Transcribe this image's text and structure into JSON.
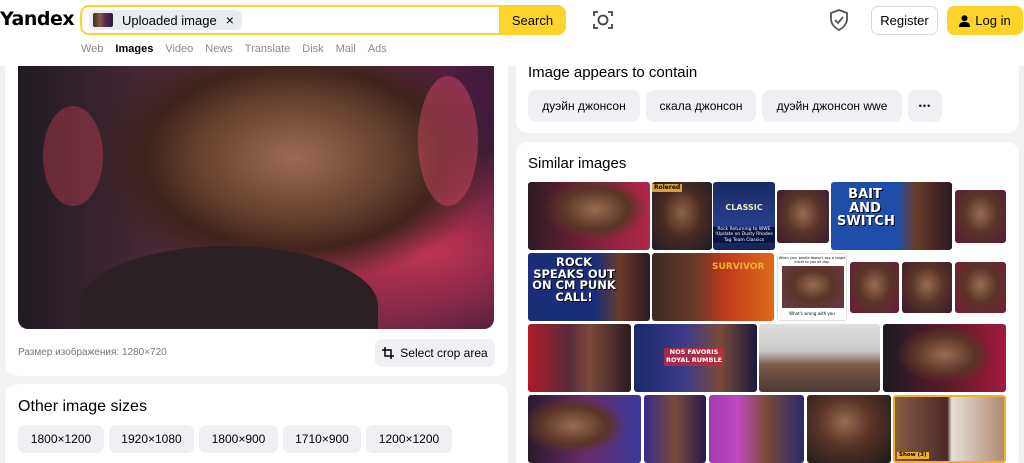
{
  "header": {
    "logo": "Yandex",
    "search": {
      "chip_label": "Uploaded image",
      "chip_close": "×",
      "button": "Search"
    },
    "register": "Register",
    "login": "Log in",
    "icons": {
      "camera": "camera-lens-icon",
      "shield": "shield-check-icon",
      "user": "user-icon"
    }
  },
  "tabs": [
    {
      "label": "Web"
    },
    {
      "label": "Images",
      "active": true
    },
    {
      "label": "Video"
    },
    {
      "label": "News"
    },
    {
      "label": "Translate"
    },
    {
      "label": "Disk"
    },
    {
      "label": "Mail"
    },
    {
      "label": "Ads"
    }
  ],
  "left": {
    "image_size_text": "Размер изображения: 1280×720",
    "crop_button": "Select crop area",
    "other_sizes_title": "Other image sizes",
    "sizes": [
      "1800×1200",
      "1920×1080",
      "1800×900",
      "1710×900",
      "1200×1200"
    ]
  },
  "right": {
    "contains_title": "Image appears to contain",
    "tags": [
      "дуэйн джонсон",
      "скала джонсон",
      "дуэйн джонсон wwe"
    ],
    "more": "•••",
    "similar_title": "Similar images",
    "thumb_texts": {
      "t2_badge": "Rolered",
      "t3_top": "CLASSIC",
      "t3_bottom": "Rock Returning to WWE !Update on Dusty Rhodes Tag Team Classics",
      "t5": "BAIT AND SWITCH",
      "t7": "ROCK SPEAKS OUT ON CM PUNK CALL!",
      "t9": "SURVIVOR",
      "t10_top": "When your bestie doesn't say a single insult to you all day.",
      "t10_bottom": "What's wrong with you",
      "t16": "NOS FAVORIS ROYAL RUMBLE",
      "t23_badge": "Show (3)"
    }
  },
  "colors": {
    "accent": "#fed42b",
    "background": "#f2f2f2",
    "chip": "#eef0f3"
  }
}
